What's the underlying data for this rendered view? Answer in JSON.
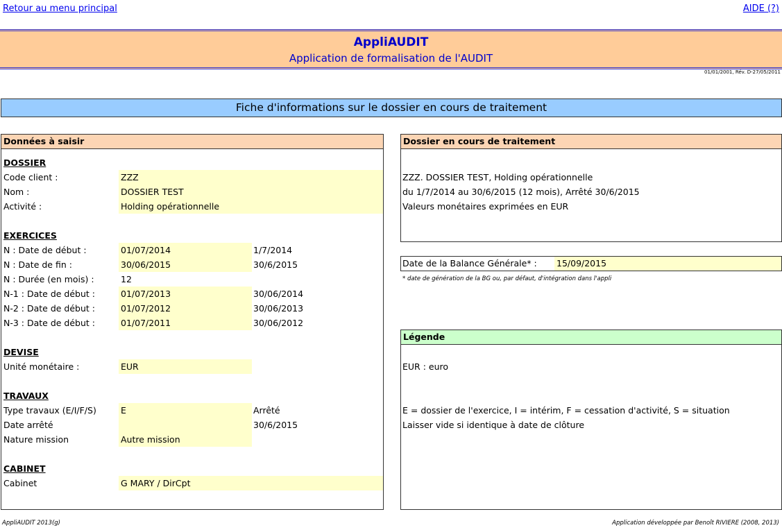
{
  "nav": {
    "back_link": "Retour au menu principal",
    "help_link": "AIDE (?)"
  },
  "header": {
    "title": "AppliAUDIT",
    "subtitle": "Application de formalisation de l'AUDIT",
    "version": "01/01/2001, Rév. D-27/05/2011"
  },
  "banner": "Fiche d'informations sur le dossier en cours de traitement",
  "left_panel": {
    "title": "Données à saisir",
    "dossier": {
      "heading": "DOSSIER",
      "rows": [
        {
          "label": "Code client :",
          "value": "ZZZ"
        },
        {
          "label": "Nom :",
          "value": "DOSSIER TEST"
        },
        {
          "label": "Activité :",
          "value": "Holding opérationnelle"
        }
      ]
    },
    "exercices": {
      "heading": "EXERCICES",
      "rows": [
        {
          "label": "N : Date de début :",
          "value": "01/07/2014",
          "calc": "1/7/2014"
        },
        {
          "label": "N : Date de fin :",
          "value": "30/06/2015",
          "calc": "30/6/2015"
        },
        {
          "label": "N : Durée (en mois) :",
          "value": "12",
          "calc": ""
        },
        {
          "label": "N-1 : Date de début :",
          "value": "01/07/2013",
          "calc": "30/06/2014"
        },
        {
          "label": "N-2 : Date de début :",
          "value": "01/07/2012",
          "calc": "30/06/2013"
        },
        {
          "label": "N-3 : Date de début :",
          "value": "01/07/2011",
          "calc": "30/06/2012"
        }
      ]
    },
    "devise": {
      "heading": "DEVISE",
      "rows": [
        {
          "label": "Unité monétaire :",
          "value": "EUR"
        }
      ]
    },
    "travaux": {
      "heading": "TRAVAUX",
      "rows": [
        {
          "label": "Type travaux (E/I/F/S)",
          "value": "E",
          "calc": "Arrêté"
        },
        {
          "label": "Date arrêté",
          "value": "",
          "calc": "30/6/2015"
        },
        {
          "label": "Nature mission",
          "value": "Autre mission",
          "calc": ""
        }
      ]
    },
    "cabinet": {
      "heading": "CABINET",
      "rows": [
        {
          "label": "Cabinet",
          "value": "G MARY / DirCpt"
        }
      ]
    }
  },
  "right_panel": {
    "title": "Dossier en cours de traitement",
    "lines": [
      "ZZZ. DOSSIER TEST, Holding opérationnelle",
      "du 1/7/2014 au 30/6/2015 (12 mois), Arrêté 30/6/2015",
      "Valeurs monétaires exprimées en EUR"
    ]
  },
  "balance": {
    "label": "Date de la Balance Générale* :",
    "value": "15/09/2015",
    "note": "* date de génération de la BG ou, par défaut, d'intégration dans l'appli"
  },
  "legend": {
    "title": "Légende",
    "devise": "EUR : euro",
    "travaux_1": "E = dossier de l'exercice, I = intérim, F = cessation d'activité, S = situation",
    "travaux_2": "Laisser vide si identique à date de clôture"
  },
  "footer": {
    "left": "AppliAUDIT 2013(g)",
    "right": "Application développée par Benoît RIVIERE (2008, 2013)"
  }
}
